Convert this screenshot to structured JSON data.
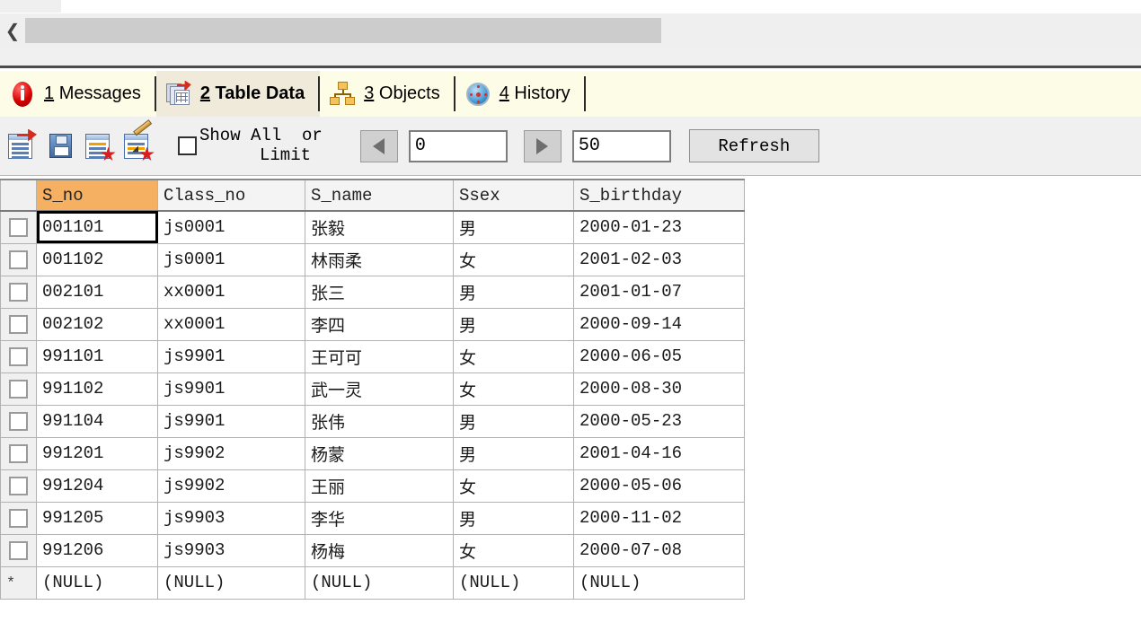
{
  "window": {
    "scrollbar": {
      "collapse_icon": "chevron-left-icon"
    }
  },
  "tabs": [
    {
      "num": "1",
      "label": "Messages",
      "icon": "info-circle-icon",
      "active": false
    },
    {
      "num": "2",
      "label": "Table Data",
      "icon": "table-records-icon",
      "active": true
    },
    {
      "num": "3",
      "label": "Objects",
      "icon": "object-tree-icon",
      "active": false
    },
    {
      "num": "4",
      "label": "History",
      "icon": "clock-icon",
      "active": false
    }
  ],
  "toolbar": {
    "icons": [
      {
        "name": "post-record-icon",
        "title": "Post Edit"
      },
      {
        "name": "save-icon",
        "title": "Save"
      },
      {
        "name": "cancel-record-icon",
        "title": "Cancel Edit"
      },
      {
        "name": "delete-record-icon",
        "title": "Delete Record"
      }
    ],
    "show_all_checkbox": {
      "checked": false,
      "label_line1": "Show All  or",
      "label_line2": "Limit"
    },
    "prev_button_icon": "triangle-left-icon",
    "next_button_icon": "triangle-right-icon",
    "offset_value": "0",
    "limit_value": "50",
    "refresh_label": "Refresh"
  },
  "grid": {
    "columns": [
      {
        "key": "s_no",
        "label": "S_no",
        "selected": true
      },
      {
        "key": "class_no",
        "label": "Class_no",
        "selected": false
      },
      {
        "key": "s_name",
        "label": "S_name",
        "selected": false
      },
      {
        "key": "ssex",
        "label": "Ssex",
        "selected": false
      },
      {
        "key": "s_birthday",
        "label": "S_birthday",
        "selected": false
      }
    ],
    "rows": [
      {
        "s_no": "001101",
        "class_no": "js0001",
        "s_name": "张毅",
        "ssex": "男",
        "s_birthday": "2000-01-23"
      },
      {
        "s_no": "001102",
        "class_no": "js0001",
        "s_name": "林雨柔",
        "ssex": "女",
        "s_birthday": "2001-02-03"
      },
      {
        "s_no": "002101",
        "class_no": "xx0001",
        "s_name": "张三",
        "ssex": "男",
        "s_birthday": "2001-01-07"
      },
      {
        "s_no": "002102",
        "class_no": "xx0001",
        "s_name": "李四",
        "ssex": "男",
        "s_birthday": "2000-09-14"
      },
      {
        "s_no": "991101",
        "class_no": "js9901",
        "s_name": "王可可",
        "ssex": "女",
        "s_birthday": "2000-06-05"
      },
      {
        "s_no": "991102",
        "class_no": "js9901",
        "s_name": "武一灵",
        "ssex": "女",
        "s_birthday": "2000-08-30"
      },
      {
        "s_no": "991104",
        "class_no": "js9901",
        "s_name": "张伟",
        "ssex": "男",
        "s_birthday": "2000-05-23"
      },
      {
        "s_no": "991201",
        "class_no": "js9902",
        "s_name": "杨蒙",
        "ssex": "男",
        "s_birthday": "2001-04-16"
      },
      {
        "s_no": "991204",
        "class_no": "js9902",
        "s_name": "王丽",
        "ssex": "女",
        "s_birthday": "2000-05-06"
      },
      {
        "s_no": "991205",
        "class_no": "js9903",
        "s_name": "李华",
        "ssex": "男",
        "s_birthday": "2000-11-02"
      },
      {
        "s_no": "991206",
        "class_no": "js9903",
        "s_name": "杨梅",
        "ssex": "女",
        "s_birthday": "2000-07-08"
      }
    ],
    "new_row": {
      "marker": "*",
      "s_no": "(NULL)",
      "class_no": "(NULL)",
      "s_name": "(NULL)",
      "ssex": "(NULL)",
      "s_birthday": "(NULL)"
    },
    "focused_cell": {
      "row": 0,
      "column": "s_no"
    }
  },
  "colors": {
    "selected_column_header": "#f6b061",
    "tab_strip": "#fdfce6",
    "active_tab": "#efeada",
    "toolbar": "#f0f0f0",
    "grid_border": "#b2b2b2",
    "null_text": "#4a3a20"
  }
}
